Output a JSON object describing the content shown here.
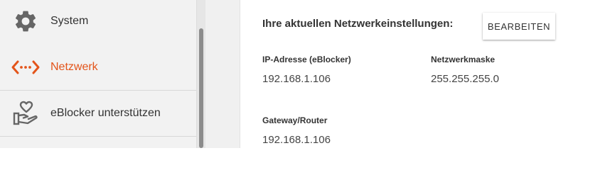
{
  "colors": {
    "accent": "#e3541a",
    "icon_gray": "#666666",
    "sidebar_bg": "#f2f2f2"
  },
  "sidebar": {
    "items": [
      {
        "label": "System",
        "icon": "gear-icon",
        "active": false
      },
      {
        "label": "Netzwerk",
        "icon": "network-arrows-icon",
        "active": true
      },
      {
        "label": "eBlocker unterstützen",
        "icon": "hand-heart-icon",
        "active": false
      }
    ]
  },
  "main": {
    "heading": "Ihre aktuellen Netzwerkeinstellungen:",
    "edit_button": "BEARBEITEN",
    "fields": {
      "ip": {
        "label": "IP-Adresse (eBlocker)",
        "value": "192.168.1.106"
      },
      "netmask": {
        "label": "Netzwerkmaske",
        "value": "255.255.255.0"
      },
      "gateway": {
        "label": "Gateway/Router",
        "value": "192.168.1.106"
      }
    }
  }
}
